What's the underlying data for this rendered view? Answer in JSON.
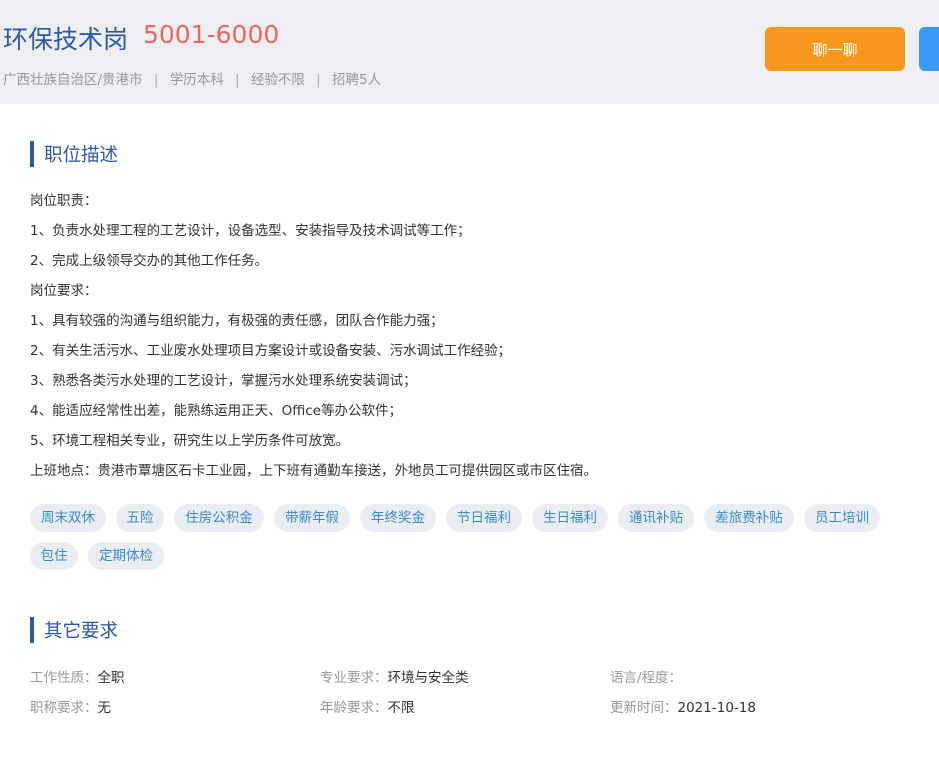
{
  "header": {
    "title": "环保技术岗",
    "salary": "5001-6000",
    "meta": [
      "广西壮族自治区/贵港市",
      "学历本科",
      "经验不限",
      "招聘5人"
    ],
    "chat_label": "聊一聊"
  },
  "description": {
    "heading": "职位描述",
    "lines": [
      "岗位职责：",
      "1、负责水处理工程的工艺设计，设备选型、安装指导及技术调试等工作；",
      "2、完成上级领导交办的其他工作任务。",
      "岗位要求：",
      "1、具有较强的沟通与组织能力，有极强的责任感，团队合作能力强；",
      "2、有关生活污水、工业废水处理项目方案设计或设备安装、污水调试工作经验；",
      "3、熟悉各类污水处理的工艺设计，掌握污水处理系统安装调试；",
      "4、能适应经常性出差，能熟练运用正天、Office等办公软件；",
      "5、环境工程相关专业，研究生以上学历条件可放宽。",
      "上班地点：贵港市覃塘区石卡工业园，上下班有通勤车接送，外地员工可提供园区或市区住宿。"
    ]
  },
  "benefits": [
    "周末双休",
    "五险",
    "住房公积金",
    "带薪年假",
    "年终奖金",
    "节日福利",
    "生日福利",
    "通讯补贴",
    "差旅费补贴",
    "员工培训",
    "包住",
    "定期体检"
  ],
  "other": {
    "heading": "其它要求",
    "items": [
      {
        "label": "工作性质：",
        "value": "全职"
      },
      {
        "label": "专业要求：",
        "value": "环境与安全类"
      },
      {
        "label": "语言/程度：",
        "value": ""
      },
      {
        "label": "职称要求：",
        "value": "无"
      },
      {
        "label": "年龄要求：",
        "value": "不限"
      },
      {
        "label": "更新时间：",
        "value": "2021-10-18"
      }
    ]
  },
  "colors": {
    "accent_blue": "#2d5aa8",
    "salary_red": "#f2665b",
    "chat_orange": "#f7981d",
    "tag_text": "#3b8ad9",
    "tag_bg": "#eaeef3"
  }
}
